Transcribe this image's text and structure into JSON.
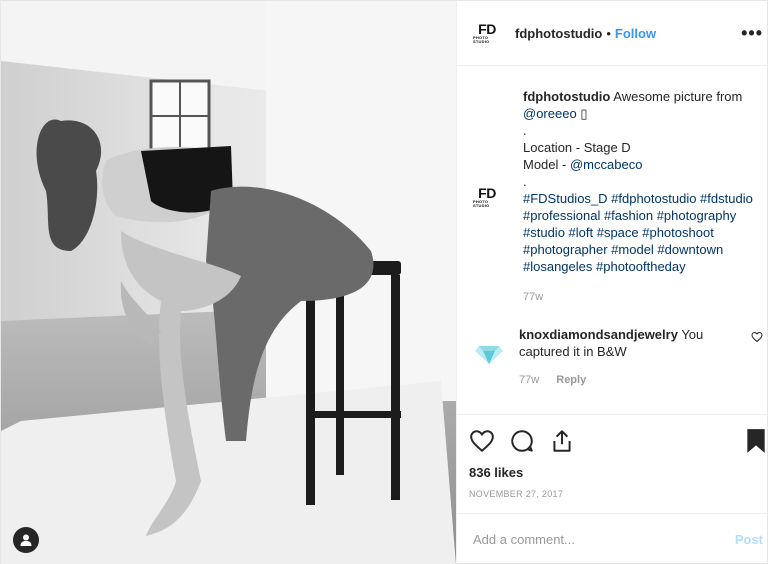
{
  "header": {
    "logo_text": "FD",
    "logo_sub": "PHOTO STUDIO",
    "username": "fdphotostudio",
    "separator": "•",
    "follow_label": "Follow",
    "more_icon": "more-icon"
  },
  "caption": {
    "username": "fdphotostudio",
    "intro": "Awesome picture from",
    "mention1": "@oreeeo",
    "glyph": "▯",
    "bullet": ".",
    "location": "Location - Stage D",
    "model_label": "Model -",
    "model_mention": "@mccabeco",
    "bullet2": ".",
    "hashtags": "#FDStudios_D #fdphotostudio #fdstudio #professional #fashion #photography #studio #loft #space #photoshoot #photographer #model #downtown #losangeles #photooftheday",
    "time": "77w"
  },
  "comment": {
    "username": "knoxdiamondsandjewelry",
    "text": "You captured it in B&W",
    "time": "77w",
    "reply_label": "Reply"
  },
  "actions": {
    "likes": "836 likes",
    "date": "NOVEMBER 27, 2017"
  },
  "add_comment": {
    "placeholder": "Add a comment...",
    "post_label": "Post"
  },
  "colors": {
    "accent": "#3897f0",
    "link": "#003569",
    "muted": "#999999"
  }
}
